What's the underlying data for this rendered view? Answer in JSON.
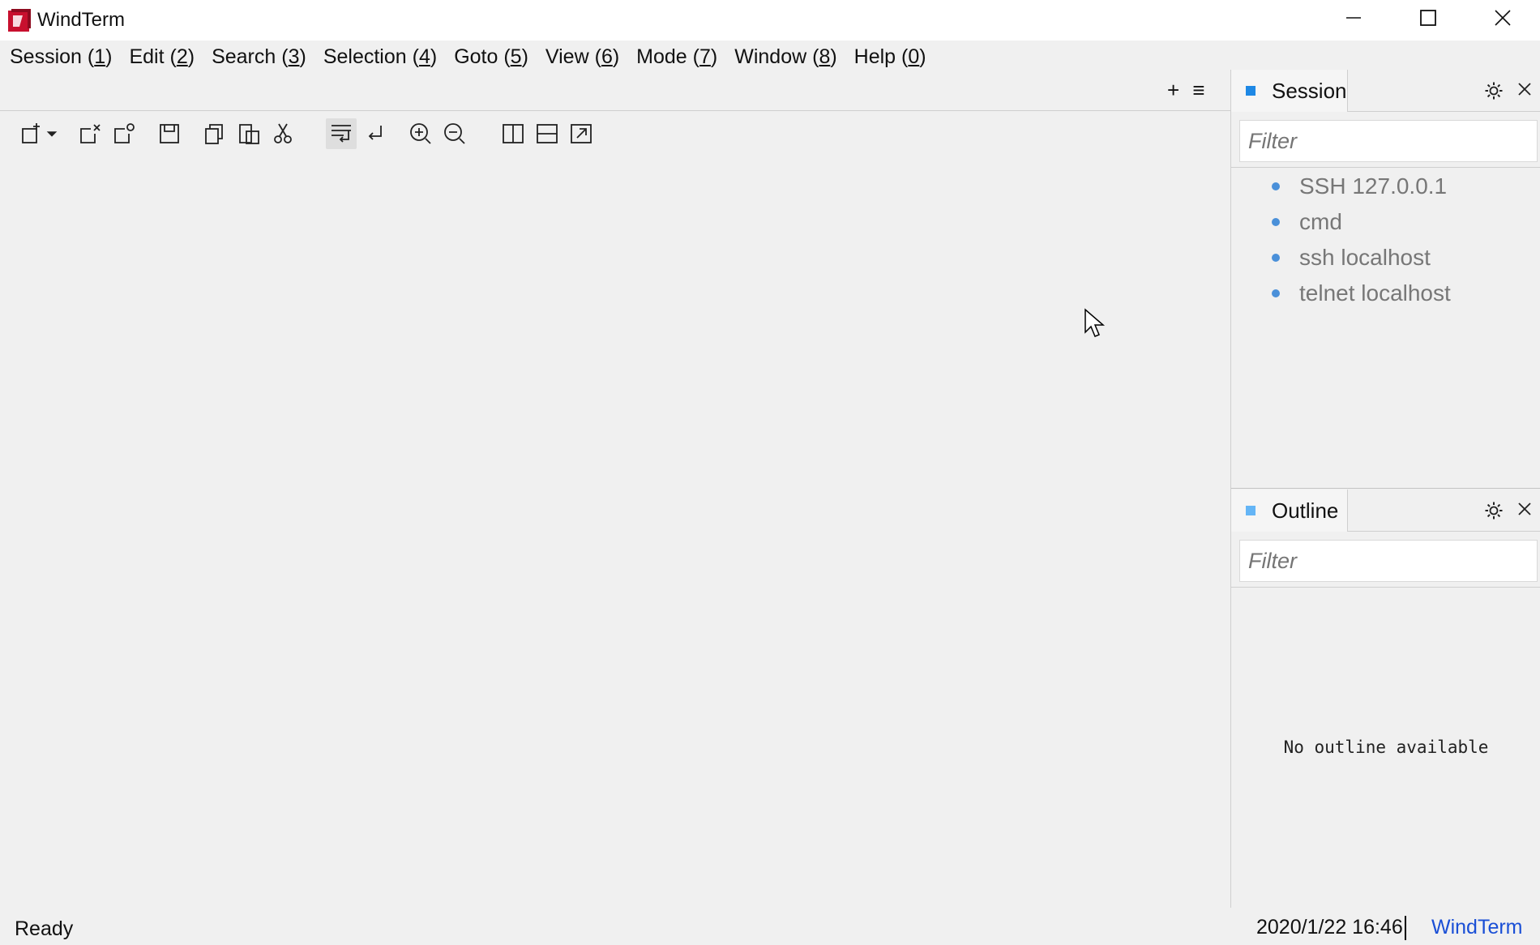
{
  "window": {
    "title": "WindTerm",
    "brand_color": "#c8102e"
  },
  "menu": [
    {
      "label": "Session",
      "mnemonic": "1"
    },
    {
      "label": "Edit",
      "mnemonic": "2"
    },
    {
      "label": "Search",
      "mnemonic": "3"
    },
    {
      "label": "Selection",
      "mnemonic": "4"
    },
    {
      "label": "Goto",
      "mnemonic": "5"
    },
    {
      "label": "View",
      "mnemonic": "6"
    },
    {
      "label": "Mode",
      "mnemonic": "7"
    },
    {
      "label": "Window",
      "mnemonic": "8"
    },
    {
      "label": "Help",
      "mnemonic": "0"
    }
  ],
  "tabstrip": {
    "add_glyph": "+",
    "menu_glyph": "≡"
  },
  "toolbar_icons": [
    "new-session-icon",
    "dropdown-arrow-icon",
    "close-session-icon",
    "duplicate-session-icon",
    "save-icon",
    "copy-icon",
    "paste-icon",
    "cut-icon",
    "word-wrap-icon",
    "line-break-icon",
    "zoom-in-icon",
    "zoom-out-icon",
    "split-vertical-icon",
    "split-horizontal-icon",
    "open-external-icon"
  ],
  "session_panel": {
    "title": "Session",
    "accent": "#1e88e5",
    "filter_placeholder": "Filter",
    "items": [
      "SSH 127.0.0.1",
      "cmd",
      "ssh localhost",
      "telnet localhost"
    ]
  },
  "outline_panel": {
    "title": "Outline",
    "accent": "#64b5f6",
    "filter_placeholder": "Filter",
    "empty_text": "No outline available"
  },
  "status": {
    "left": "Ready",
    "datetime": "2020/1/22 16:46",
    "app": "WindTerm",
    "app_color": "#1a4fd6"
  }
}
